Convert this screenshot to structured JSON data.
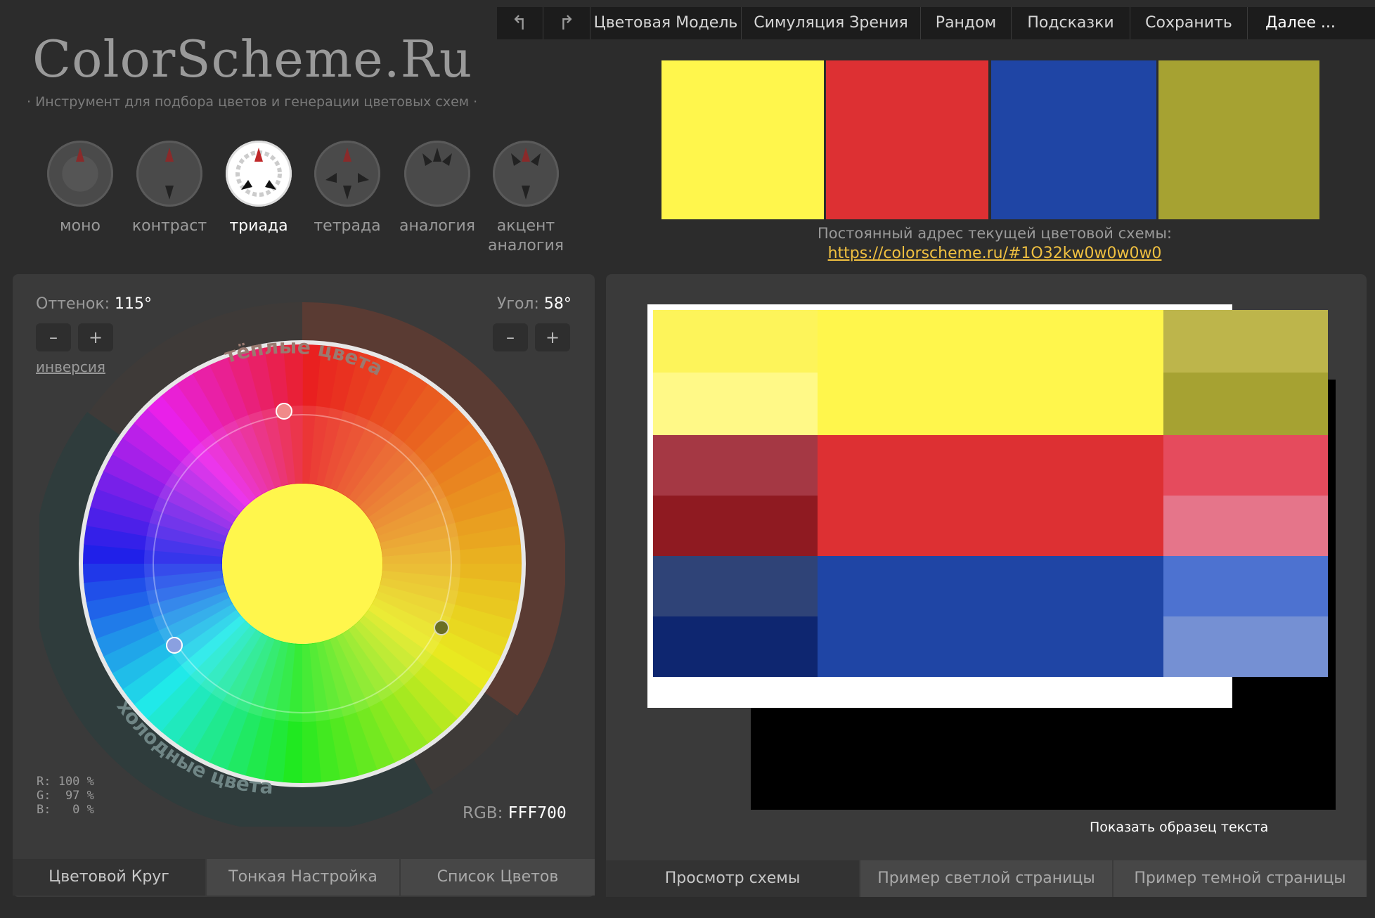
{
  "toolbar": {
    "undo_icon": "undo-icon",
    "redo_icon": "redo-icon",
    "items": [
      "Цветовая Модель",
      "Симуляция Зрения",
      "Рандом",
      "Подсказки",
      "Сохранить",
      "Далее ..."
    ]
  },
  "logo": "ColorScheme.Ru",
  "tagline": "· Инструмент для подбора цветов и генерации цветовых схем ·",
  "scheme_types": [
    {
      "label": "моно",
      "active": false
    },
    {
      "label": "контраст",
      "active": false
    },
    {
      "label": "триада",
      "active": true
    },
    {
      "label": "тетрада",
      "active": false
    },
    {
      "label": "аналогия",
      "active": false
    },
    {
      "label": "акцент\nаналогия",
      "active": false
    }
  ],
  "top_strip": [
    "#fff64c",
    "#dd3033",
    "#1f45a5",
    "#a6a232"
  ],
  "permalink": {
    "label": "Постоянный адрес текущей цветовой схемы:",
    "url": "https://colorscheme.ru/#1O32kw0w0w0w0"
  },
  "wheel_panel": {
    "hue_label": "Оттенок:",
    "hue_value": "115°",
    "angle_label": "Угол:",
    "angle_value": "58°",
    "minus": "–",
    "plus": "+",
    "inversion": "инверсия",
    "warm_label": "тёплые цвета",
    "cold_label": "холодные цвета",
    "center_color": "#fff64c",
    "rgb_r": "R: 100 %",
    "rgb_g": "G:  97 %",
    "rgb_b": "B:   0 %",
    "rgb_label": "RGB:",
    "rgb_value": "FFF700"
  },
  "left_tabs": [
    "Цветовой Круг",
    "Тонкая Настройка",
    "Список Цветов"
  ],
  "right_tabs": [
    "Просмотр схемы",
    "Пример светлой страницы",
    "Пример темной страницы"
  ],
  "preview": {
    "show_text": "Показать образец текста",
    "rows": [
      {
        "left": [
          "#fdf45a",
          "#fff987"
        ],
        "main": "#fff64c",
        "right": [
          "#bdb54b",
          "#a6a232"
        ]
      },
      {
        "left": [
          "#a53844",
          "#8f1a21"
        ],
        "main": "#dd3033",
        "right": [
          "#e54b5d",
          "#e5758a"
        ]
      },
      {
        "left": [
          "#2f4377",
          "#0e2670"
        ],
        "main": "#1f45a5",
        "right": [
          "#4d72d0",
          "#7590d3"
        ]
      }
    ]
  }
}
